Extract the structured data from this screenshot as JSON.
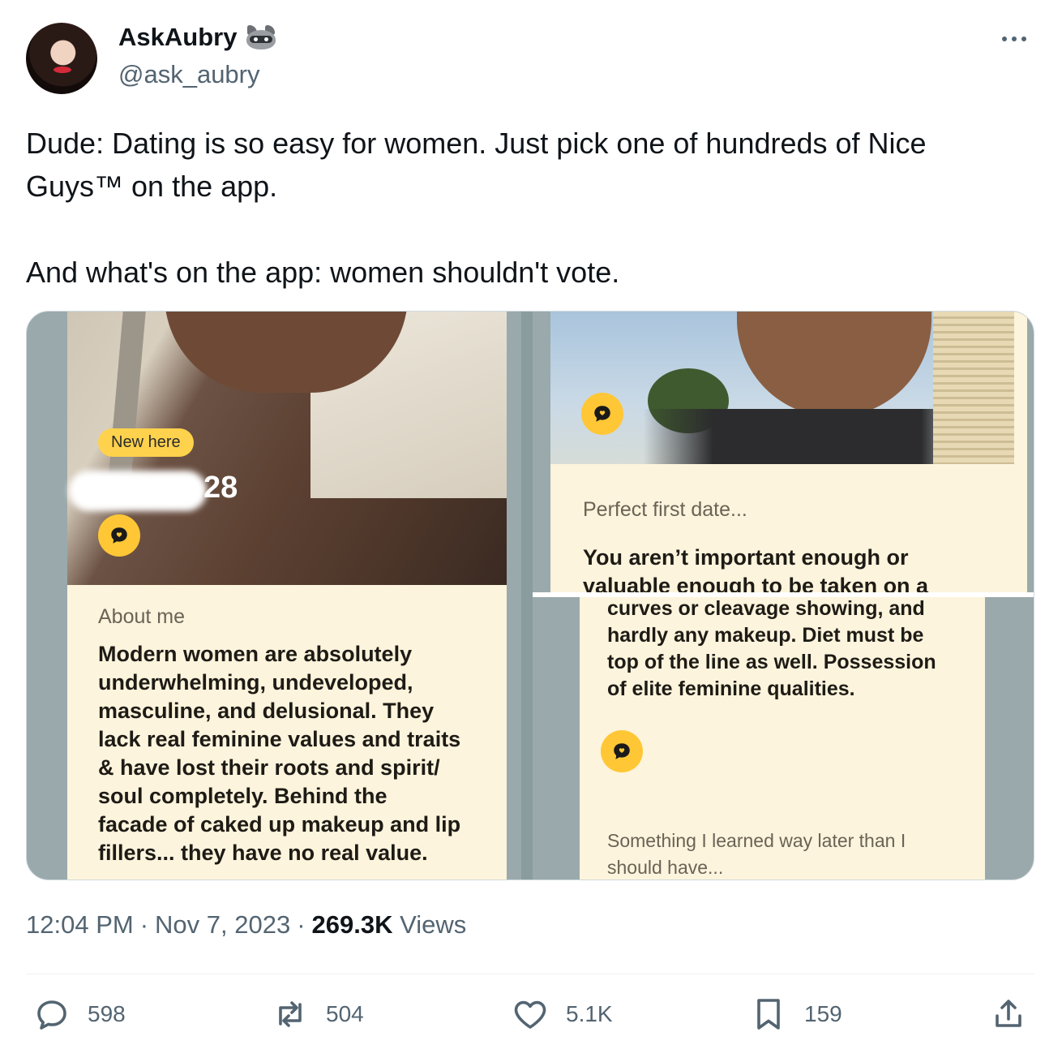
{
  "author": {
    "display_name": "AskAubry",
    "emoji_icon": "raccoon-icon",
    "handle": "@ask_aubry"
  },
  "tweet": {
    "lines": [
      "Dude: Dating is so easy for women. Just pick one of hundreds of Nice",
      "Guys™ on the app.",
      "And what's on the app: women shouldn't vote."
    ]
  },
  "media": {
    "left_panel": {
      "badge": "New here",
      "age": "28",
      "section_label": "About me",
      "section_body": [
        "Modern women are absolutely",
        "underwhelming, undeveloped,",
        "masculine, and delusional. They",
        "lack real feminine values and traits",
        "& have lost their roots and spirit/",
        "soul completely. Behind the",
        "facade of caked up makeup and lip",
        "fillers... they have no real value."
      ]
    },
    "right_top_panel": {
      "section_label": "Perfect first date...",
      "section_body": [
        "You aren’t important enough or",
        "valuable enough to be taken on a"
      ]
    },
    "right_bottom_panel": {
      "section_body": [
        "curves or cleavage showing, and",
        "hardly any makeup. Diet must be",
        "top of the line as well. Possession",
        "of elite feminine qualities."
      ],
      "prompt_label": [
        "Something I learned way later than I",
        "should have..."
      ]
    }
  },
  "meta": {
    "time": "12:04 PM",
    "sep1": "·",
    "date": "Nov 7, 2023",
    "sep2": "·",
    "views_count": "269.3K",
    "views_label": "Views"
  },
  "actions": {
    "replies": "598",
    "reposts": "504",
    "likes": "5.1K",
    "bookmarks": "159"
  },
  "colors": {
    "accent_yellow": "#ffc735",
    "card_cream": "#fcf4dc",
    "muted_text": "#536471"
  }
}
